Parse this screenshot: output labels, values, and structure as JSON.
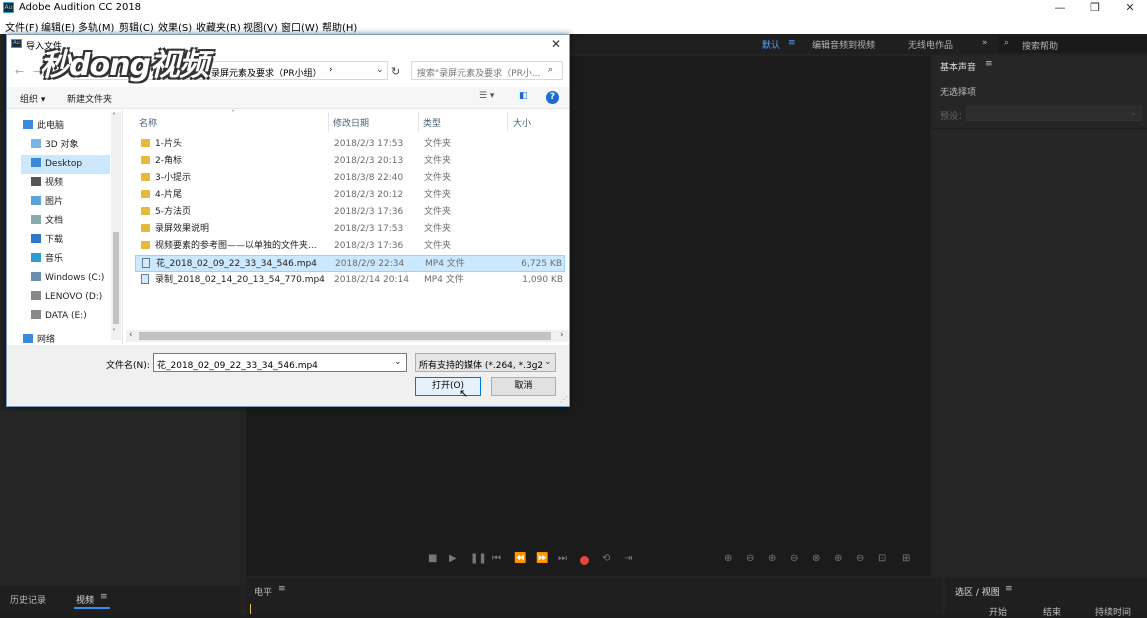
{
  "app": {
    "title": "Adobe Audition CC 2018",
    "icon_label": "Au"
  },
  "menu": [
    "文件(F)",
    "编辑(E)",
    "多轨(M)",
    "剪辑(C)",
    "效果(S)",
    "收藏夹(R)",
    "视图(V)",
    "窗口(W)",
    "帮助(H)"
  ],
  "workspace": {
    "default": "默认",
    "edit_to_video": "编辑音频到视频",
    "wireless": "无线电作品",
    "search_placeholder": "搜索帮助"
  },
  "basic_sound": {
    "title": "基本声音",
    "no_selection": "无选择项",
    "preset_label": "预设："
  },
  "bottom": {
    "history": "历史记录",
    "video": "视频",
    "levels": "电平",
    "selection_view": "选区 / 视图",
    "start": "开始",
    "end": "结束",
    "duration": "持续时间"
  },
  "dialog": {
    "title": "导入文件",
    "breadcrumb": "录屏元素及要求（PR小组）",
    "search_placeholder": "搜索\"录屏元素及要求（PR小...",
    "organize": "组织 ▾",
    "new_folder": "新建文件夹",
    "nav": [
      {
        "label": "此电脑",
        "icon": "computer-icon"
      },
      {
        "label": "3D 对象",
        "icon": "cube-icon"
      },
      {
        "label": "Desktop",
        "icon": "desktop-icon",
        "selected": true
      },
      {
        "label": "视频",
        "icon": "video-icon"
      },
      {
        "label": "图片",
        "icon": "picture-icon"
      },
      {
        "label": "文档",
        "icon": "document-icon"
      },
      {
        "label": "下载",
        "icon": "download-icon"
      },
      {
        "label": "音乐",
        "icon": "music-icon"
      },
      {
        "label": "Windows (C:)",
        "icon": "drive-icon"
      },
      {
        "label": "LENOVO (D:)",
        "icon": "drive-icon"
      },
      {
        "label": "DATA (E:)",
        "icon": "drive-icon"
      },
      {
        "label": "网络",
        "icon": "network-icon"
      }
    ],
    "columns": {
      "name": "名称",
      "date": "修改日期",
      "type": "类型",
      "size": "大小"
    },
    "files": [
      {
        "name": "1-片头",
        "date": "2018/2/3 17:53",
        "type": "文件夹",
        "size": "",
        "kind": "folder"
      },
      {
        "name": "2-角标",
        "date": "2018/2/3 20:13",
        "type": "文件夹",
        "size": "",
        "kind": "folder"
      },
      {
        "name": "3-小提示",
        "date": "2018/3/8 22:40",
        "type": "文件夹",
        "size": "",
        "kind": "folder"
      },
      {
        "name": "4-片尾",
        "date": "2018/2/3 20:12",
        "type": "文件夹",
        "size": "",
        "kind": "folder"
      },
      {
        "name": "5-方法页",
        "date": "2018/2/3 17:36",
        "type": "文件夹",
        "size": "",
        "kind": "folder"
      },
      {
        "name": "录屏效果说明",
        "date": "2018/2/3 17:53",
        "type": "文件夹",
        "size": "",
        "kind": "folder"
      },
      {
        "name": "视频要素的参考图——以单独的文件夹...",
        "date": "2018/2/3 17:36",
        "type": "文件夹",
        "size": "",
        "kind": "folder"
      },
      {
        "name": "花_2018_02_09_22_33_34_546.mp4",
        "date": "2018/2/9 22:34",
        "type": "MP4 文件",
        "size": "6,725 KB",
        "kind": "video",
        "selected": true
      },
      {
        "name": "录制_2018_02_14_20_13_54_770.mp4",
        "date": "2018/2/14 20:14",
        "type": "MP4 文件",
        "size": "1,090 KB",
        "kind": "video"
      }
    ],
    "filename_label": "文件名(N):",
    "filename_value": "花_2018_02_09_22_33_34_546.mp4",
    "filter_value": "所有支持的媒体 (*.264, *.3g2,",
    "open_label": "打开(O)",
    "cancel_label": "取消"
  },
  "watermark": "秒dong视频"
}
